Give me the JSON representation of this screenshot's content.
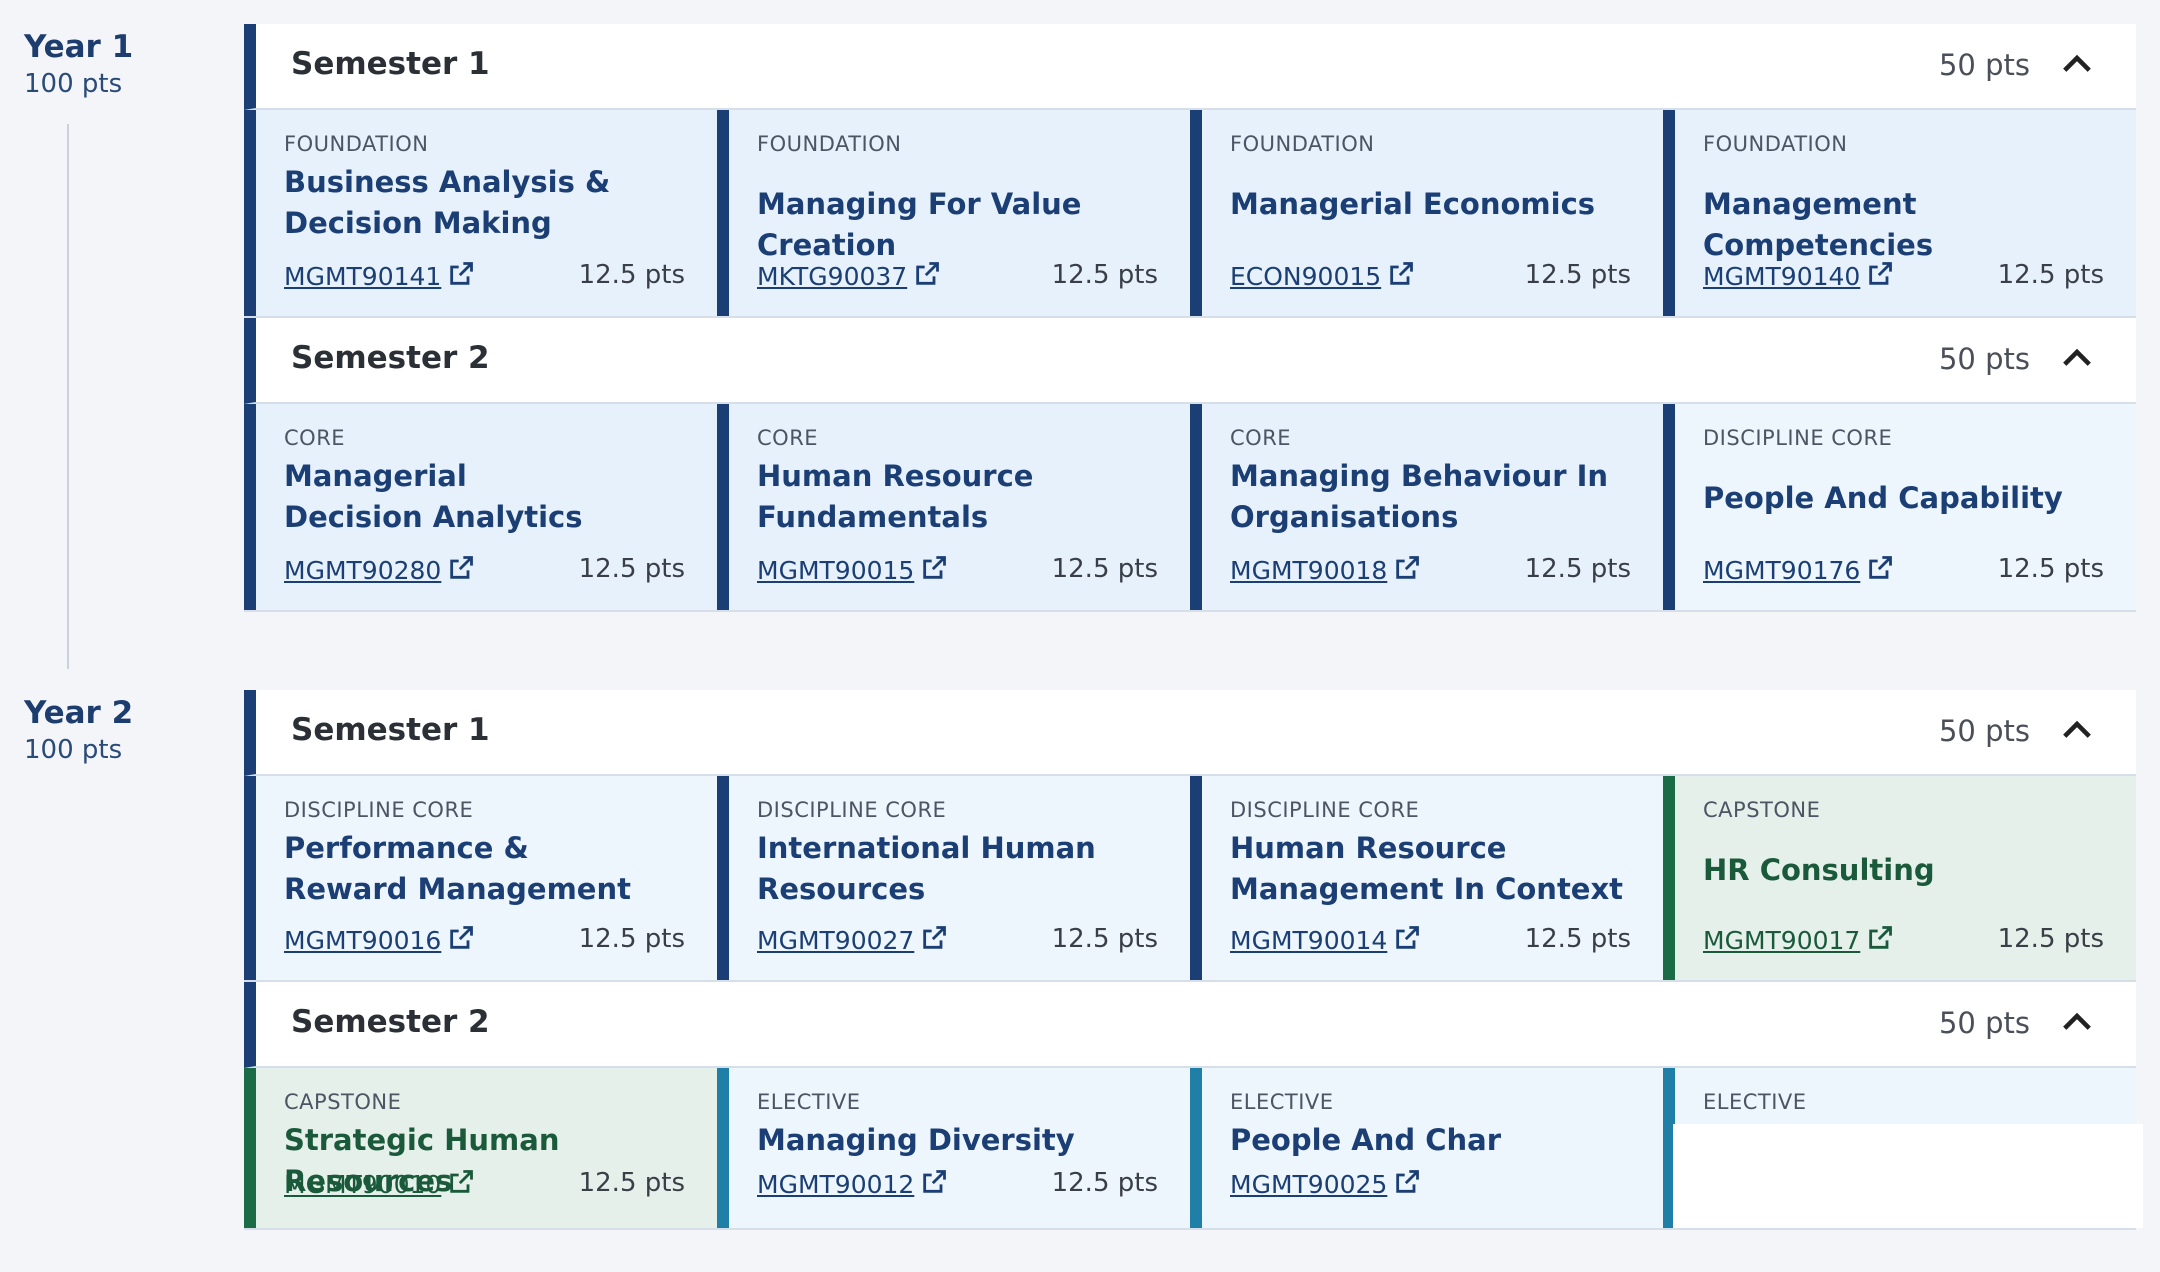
{
  "years": [
    {
      "title": "Year 1",
      "pts": "100 pts",
      "semesters": [
        {
          "title": "Semester 1",
          "pts": "50 pts",
          "subjects": [
            {
              "type": "FOUNDATION",
              "title": "Business Analysis & Decision Making",
              "code": "MGMT90141",
              "pts": "12.5 pts"
            },
            {
              "type": "FOUNDATION",
              "title": "Managing For Value Creation",
              "code": "MKTG90037",
              "pts": "12.5 pts"
            },
            {
              "type": "FOUNDATION",
              "title": "Managerial Economics",
              "code": "ECON90015",
              "pts": "12.5 pts"
            },
            {
              "type": "FOUNDATION",
              "title": "Management Competencies",
              "code": "MGMT90140",
              "pts": "12.5 pts"
            }
          ]
        },
        {
          "title": "Semester 2",
          "pts": "50 pts",
          "subjects": [
            {
              "type": "CORE",
              "title": "Managerial Decision Analytics",
              "code": "MGMT90280",
              "pts": "12.5 pts"
            },
            {
              "type": "CORE",
              "title": "Human Resource Fundamentals",
              "code": "MGMT90015",
              "pts": "12.5 pts"
            },
            {
              "type": "CORE",
              "title": "Managing Behaviour In Organisations",
              "code": "MGMT90018",
              "pts": "12.5 pts"
            },
            {
              "type": "DISCIPLINE CORE",
              "title": "People And Capability",
              "code": "MGMT90176",
              "pts": "12.5 pts"
            }
          ]
        }
      ]
    },
    {
      "title": "Year 2",
      "pts": "100 pts",
      "semesters": [
        {
          "title": "Semester 1",
          "pts": "50 pts",
          "subjects": [
            {
              "type": "DISCIPLINE CORE",
              "title": "Performance & Reward Management",
              "code": "MGMT90016",
              "pts": "12.5 pts"
            },
            {
              "type": "DISCIPLINE CORE",
              "title": "International Human Resources",
              "code": "MGMT90027",
              "pts": "12.5 pts"
            },
            {
              "type": "DISCIPLINE CORE",
              "title": "Human Resource Management In Context",
              "code": "MGMT90014",
              "pts": "12.5 pts"
            },
            {
              "type": "CAPSTONE",
              "title": "HR Consulting",
              "code": "MGMT90017",
              "pts": "12.5 pts"
            }
          ]
        },
        {
          "title": "Semester 2",
          "pts": "50 pts",
          "subjects": [
            {
              "type": "CAPSTONE",
              "title": "Strategic Human Resources",
              "code": "MGMT90010",
              "pts": "12.5 pts"
            },
            {
              "type": "ELECTIVE",
              "title": "Managing Diversity",
              "code": "MGMT90012",
              "pts": "12.5 pts"
            },
            {
              "type": "ELECTIVE",
              "title": "People And Char",
              "code": "MGMT90025",
              "pts": ""
            },
            {
              "type": "ELECTIVE",
              "title": "",
              "code": "",
              "pts": ""
            }
          ]
        }
      ]
    }
  ],
  "icons": {
    "external_link": "external-link-icon",
    "collapse": "chevron-up-icon"
  },
  "colors": {
    "navy": "#1b3f74",
    "capstone": "#1a6b46",
    "elective": "#1f7fa6"
  }
}
